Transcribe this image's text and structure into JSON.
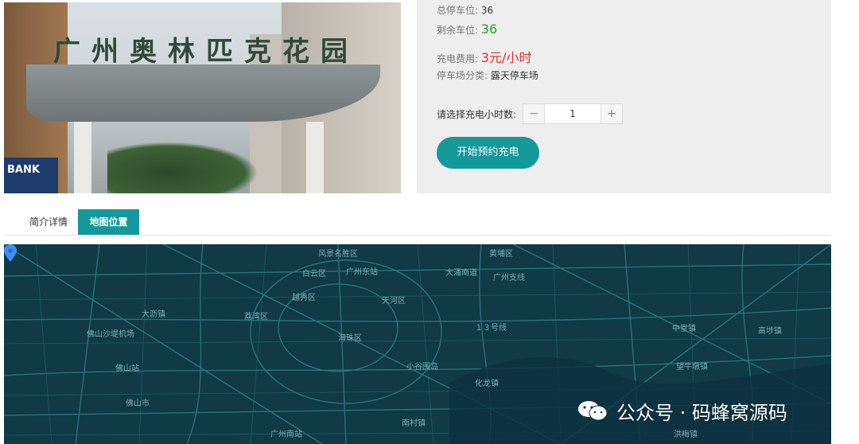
{
  "photo": {
    "sign_text": "广州奥林匹克花园",
    "bank_text": "BANK"
  },
  "info": {
    "total_label": "总停车位:",
    "total_value": "36",
    "remaining_label": "剩余车位:",
    "remaining_value": "36",
    "fee_label": "充电费用:",
    "fee_value": "3元/小时",
    "category_label": "停车场分类:",
    "category_value": "露天停车场",
    "hours_label": "请选择充电小时数:",
    "hours_value": "1",
    "minus": "−",
    "plus": "+",
    "book_button": "开始预约充电"
  },
  "tabs": [
    {
      "label": "简介详情",
      "active": false
    },
    {
      "label": "地图位置",
      "active": true
    }
  ],
  "map": {
    "labels": [
      "风景名胜区",
      "黄埔区",
      "白云区",
      "广州东站",
      "大涌南道",
      "广州支线",
      "越秀区",
      "天河区",
      "大沥镇",
      "荔湾区",
      "佛山沙堤机场",
      "海珠区",
      "１３号线",
      "中堂镇",
      "高埗镇",
      "佛山站",
      "小谷围岛",
      "望牛墩镇",
      "化龙镇",
      "佛山市",
      "南村镇",
      "广州南站",
      "洪梅镇"
    ]
  },
  "watermark": {
    "text": "公众号 · 码蜂窝源码"
  },
  "colors": {
    "accent": "#13999a",
    "green_value": "#2ca02c",
    "red_value": "#e0302a",
    "map_bg": "#0f3a46"
  }
}
